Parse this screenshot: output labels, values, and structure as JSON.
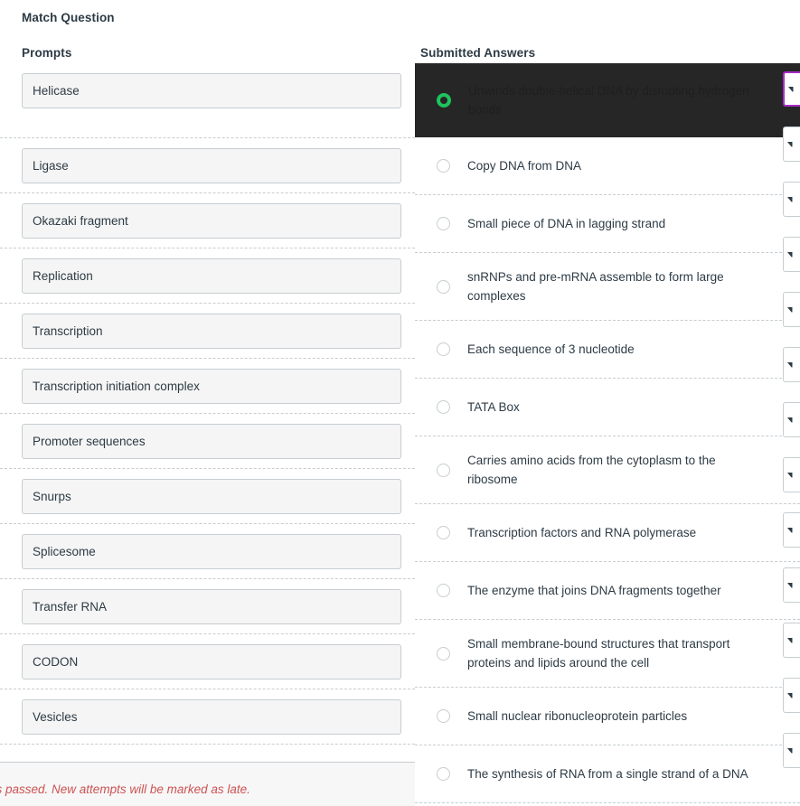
{
  "page": {
    "title": "Match Question"
  },
  "prompts": {
    "header": "Prompts",
    "items": [
      {
        "label": "Helicase"
      },
      {
        "label": "Ligase"
      },
      {
        "label": "Okazaki fragment"
      },
      {
        "label": "Replication"
      },
      {
        "label": "Transcription"
      },
      {
        "label": "Transcription initiation complex"
      },
      {
        "label": "Promoter sequences"
      },
      {
        "label": "Snurps"
      },
      {
        "label": "Splicesome"
      },
      {
        "label": "Transfer RNA"
      },
      {
        "label": "CODON"
      },
      {
        "label": "Vesicles"
      }
    ]
  },
  "answers": {
    "header": "Submitted Answers",
    "items": [
      {
        "label": "Unwinds double-helical DNA by disrupting hydrogen bonds",
        "selected": true
      },
      {
        "label": "Copy DNA from DNA",
        "selected": false
      },
      {
        "label": "Small piece of DNA in lagging strand",
        "selected": false
      },
      {
        "label": "snRNPs and pre-mRNA assemble to form large complexes",
        "selected": false
      },
      {
        "label": "Each sequence of 3 nucleotide",
        "selected": false
      },
      {
        "label": "TATA Box",
        "selected": false
      },
      {
        "label": "Carries amino acids from the cytoplasm to the ribosome",
        "selected": false
      },
      {
        "label": "Transcription factors and RNA polymerase",
        "selected": false
      },
      {
        "label": "The enzyme that joins DNA fragments together",
        "selected": false
      },
      {
        "label": "Small membrane-bound structures that transport proteins and lipids around the cell",
        "selected": false
      },
      {
        "label": "Small nuclear ribonucleoprotein particles",
        "selected": false
      },
      {
        "label": "The synthesis of RNA from a single strand of a DNA",
        "selected": false
      }
    ]
  },
  "dropdowns": {
    "count": 13,
    "icon": "chevron-down-icon",
    "focused_index": 0
  },
  "alert": {
    "text": "as passed. New attempts will be marked as late."
  },
  "colors": {
    "selected_row_bg": "#262626",
    "selected_radio": "#1ec25c",
    "focus_border": "#a32cc4",
    "alert_text": "#cc5252",
    "prompt_box_bg": "#f5f5f5",
    "border": "#c7cdd1",
    "text": "#2d3b45"
  }
}
